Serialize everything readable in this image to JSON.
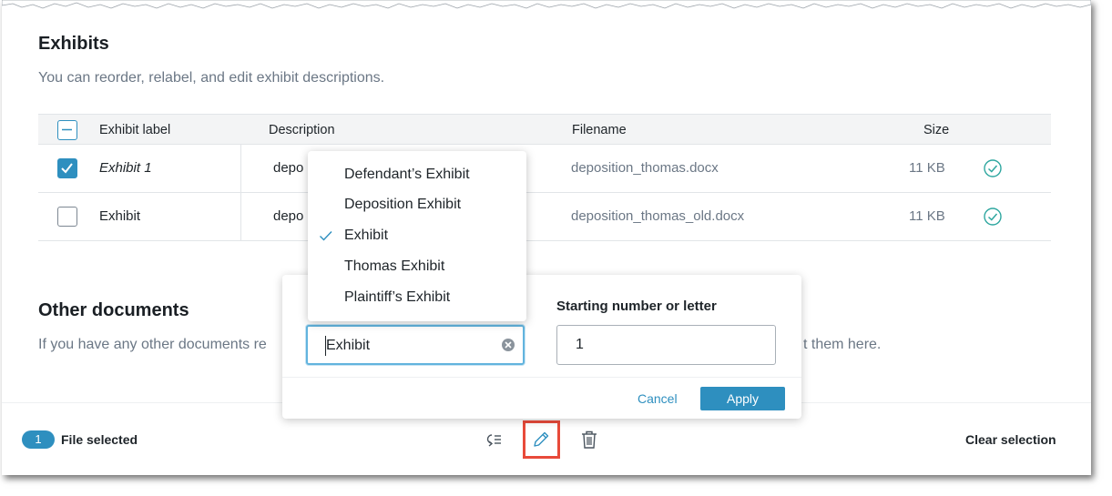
{
  "exhibits": {
    "title": "Exhibits",
    "subtitle": "You can reorder, relabel, and edit exhibit descriptions.",
    "columns": {
      "label": "Exhibit label",
      "description": "Description",
      "filename": "Filename",
      "size": "Size"
    },
    "rows": [
      {
        "label": "Exhibit 1",
        "description": "depo",
        "filename": "deposition_thomas.docx",
        "size": "11 KB",
        "checked": true
      },
      {
        "label": "Exhibit",
        "description": "depo",
        "filename": "deposition_thomas_old.docx",
        "size": "11 KB",
        "checked": false
      }
    ]
  },
  "other_documents": {
    "title": "Other documents",
    "subtitle_left": "If you have any other documents re",
    "subtitle_right": "t them here."
  },
  "relabel_popover": {
    "label_input_value": "Exhibit",
    "start_label": "Starting number or letter",
    "start_value": "1",
    "cancel": "Cancel",
    "apply": "Apply"
  },
  "label_menu": {
    "items": [
      "Defendant’s Exhibit",
      "Deposition Exhibit",
      "Exhibit",
      "Thomas Exhibit",
      "Plaintiff’s Exhibit"
    ],
    "selected": "Exhibit"
  },
  "bulk_bar": {
    "count": "1",
    "selected_text": "File selected",
    "clear_selection": "Clear selection"
  },
  "colors": {
    "accent": "#2e8fbf",
    "success": "#2fa7a0",
    "highlight": "#e84a3a",
    "muted_text": "#6b7785"
  },
  "icons": [
    "reorder-icon",
    "edit-pencil-icon",
    "trash-icon",
    "check-circle-icon",
    "clear-circle-icon",
    "checkmark-icon"
  ]
}
